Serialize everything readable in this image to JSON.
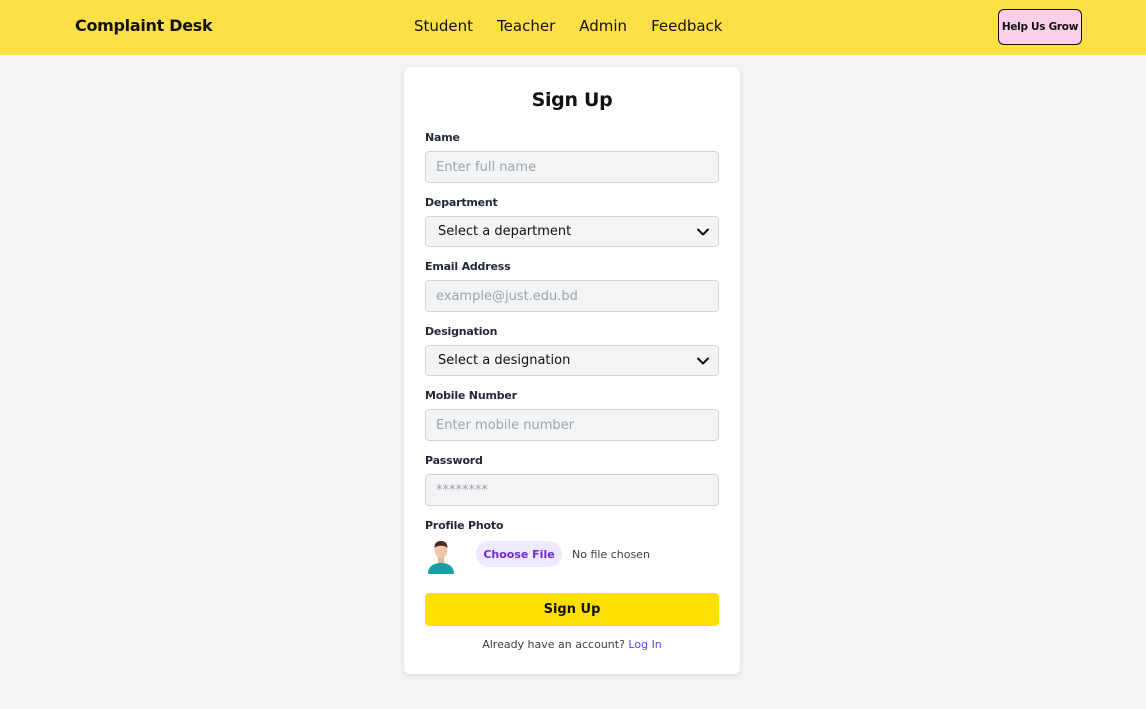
{
  "navbar": {
    "brand": "Complaint Desk",
    "links": [
      "Student",
      "Teacher",
      "Admin",
      "Feedback"
    ],
    "help_button": "Help Us Grow"
  },
  "form": {
    "title": "Sign Up",
    "name": {
      "label": "Name",
      "placeholder": "Enter full name"
    },
    "department": {
      "label": "Department",
      "selected": "Select a department"
    },
    "email": {
      "label": "Email Address",
      "placeholder": "example@just.edu.bd"
    },
    "designation": {
      "label": "Designation",
      "selected": "Select a designation"
    },
    "mobile": {
      "label": "Mobile Number",
      "placeholder": "Enter mobile number"
    },
    "password": {
      "label": "Password",
      "placeholder": "********"
    },
    "photo": {
      "label": "Profile Photo",
      "button": "Choose File",
      "status": "No file chosen"
    },
    "submit": "Sign Up",
    "footer": {
      "text": "Already have an account?",
      "link": "Log In"
    }
  },
  "colors": {
    "navbar": "#fde047",
    "help_button_bg": "#fbcfe8",
    "submit_bg": "#fde000",
    "link": "#4f46e5",
    "file_button_text": "#6d28d9"
  },
  "icons": {
    "select_arrow": "chevron-down-icon",
    "avatar": "user-avatar-icon"
  }
}
